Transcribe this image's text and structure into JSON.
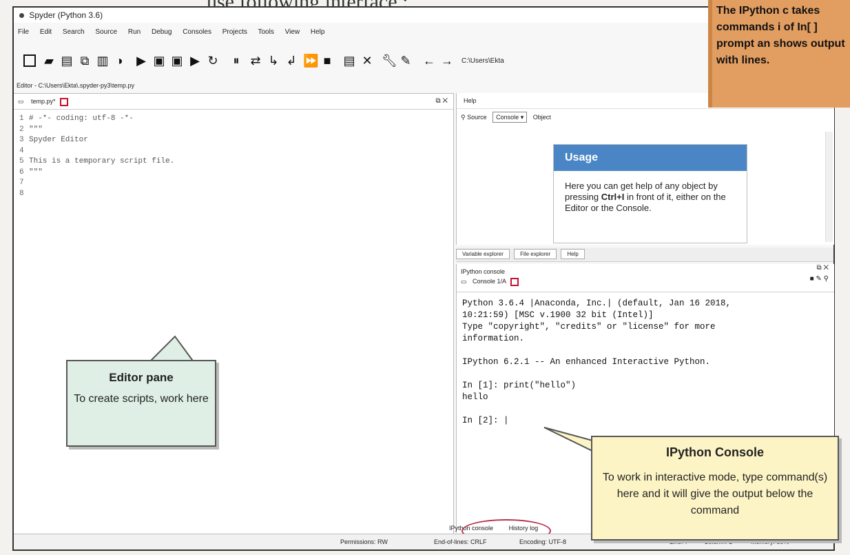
{
  "page": {
    "heading_fragment": "use following interface :"
  },
  "window": {
    "title": "Spyder (Python 3.6)"
  },
  "menu": [
    "File",
    "Edit",
    "Search",
    "Source",
    "Run",
    "Debug",
    "Consoles",
    "Projects",
    "Tools",
    "View",
    "Help"
  ],
  "toolbar": {
    "path_text": "C:\\Users\\Ekta"
  },
  "editor": {
    "path": "Editor - C:\\Users\\Ekta\\.spyder-py3\\temp.py",
    "tab_label": "temp.py*",
    "lines": [
      {
        "n": "1",
        "text": "# -*- coding: utf-8 -*-"
      },
      {
        "n": "2",
        "text": "\"\"\""
      },
      {
        "n": "3",
        "text": "Spyder Editor"
      },
      {
        "n": "4",
        "text": ""
      },
      {
        "n": "5",
        "text": "This is a temporary script file."
      },
      {
        "n": "6",
        "text": "\"\"\""
      },
      {
        "n": "7",
        "text": ""
      },
      {
        "n": "8",
        "text": ""
      }
    ]
  },
  "help": {
    "title": "Help",
    "source_label": "Source",
    "source_value": "Console",
    "object_label": "Object",
    "usage_title": "Usage",
    "usage_text_1": "Here you can get help of any object by pressing ",
    "usage_key": "Ctrl+I",
    "usage_text_2": " in front of it, either on the Editor or the Console."
  },
  "lower_tabs": [
    "Variable explorer",
    "File explorer",
    "Help"
  ],
  "console": {
    "title": "IPython console",
    "tab_label": "Console 1/A",
    "lines": [
      "Python 3.6.4 |Anaconda, Inc.| (default, Jan 16 2018,",
      "10:21:59) [MSC v.1900 32 bit (Intel)]",
      "Type \"copyright\", \"credits\" or \"license\" for more",
      "information.",
      "",
      "IPython 6.2.1 -- An enhanced Interactive Python.",
      "",
      "In [1]: print(\"hello\")",
      "hello",
      "",
      "In [2]: |"
    ],
    "bottom_tabs": [
      "IPython console",
      "History log"
    ]
  },
  "status": {
    "permissions": "Permissions: RW",
    "eol": "End-of-lines: CRLF",
    "encoding": "Encoding: UTF-8",
    "line": "Line: 7",
    "column": "Column: 1",
    "memory": "Memory: 59%"
  },
  "callouts": {
    "editor_title": "Editor pane",
    "editor_body": "To create scripts, work here",
    "console_title": "IPython Console",
    "console_body": "To work in interactive mode, type command(s) here and it will give the output below the command",
    "note_text": "The IPython c takes commands i of In[ ] prompt an shows output with lines."
  },
  "colors": {
    "usage_header": "#4a86c6",
    "editor_callout": "#dfefe6",
    "console_callout": "#fdf4c6",
    "note": "#e29d61",
    "highlight_oval": "#b8344e"
  }
}
